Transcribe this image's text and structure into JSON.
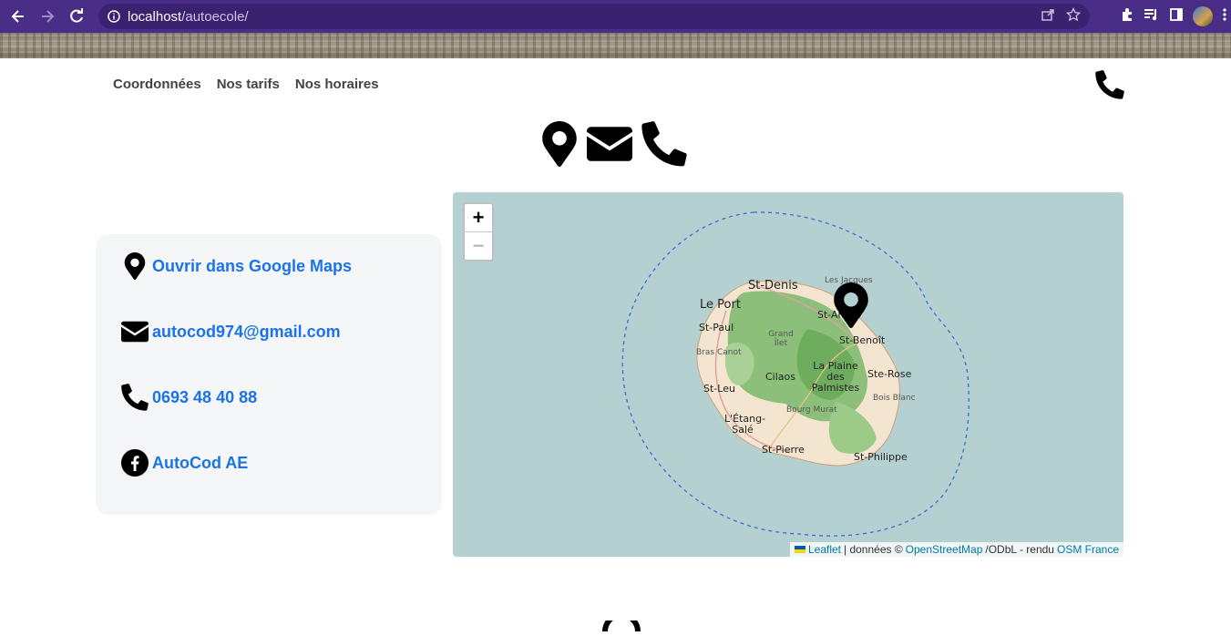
{
  "browser": {
    "url_host": "localhost",
    "url_path": "/autoecole/"
  },
  "nav": {
    "items": [
      "Coordonnées",
      "Nos tarifs",
      "Nos horaires"
    ]
  },
  "contact": {
    "maps_label": "Ouvrir dans Google Maps",
    "email": "autocod974@gmail.com",
    "phone": "0693 48 40 88",
    "facebook": "AutoCod AE"
  },
  "map": {
    "zoom_in": "+",
    "zoom_out": "−",
    "attribution": {
      "leaflet": "Leaflet",
      "sep": "| données ©",
      "osm": "OpenStreetMap",
      "odbl": "/ODbL - rendu",
      "osmfr": "OSM France"
    },
    "places": {
      "st_denis": "St-Denis",
      "le_port": "Le Port",
      "les_jacques": "Les Jacques",
      "st_andre": "St-André",
      "st_paul": "St-Paul",
      "grand_ilet": "Grand Îlet",
      "st_benoit": "St-Benoît",
      "bras_canot": "Bras Canot",
      "cilaos": "Cilaos",
      "la_plaine": "La Plaine des Palmistes",
      "ste_rose": "Ste-Rose",
      "st_leu": "St-Leu",
      "bois_blanc": "Bois Blanc",
      "bourg_murat": "Bourg Murat",
      "etang_sale": "L'Étang-Salé",
      "st_pierre": "St-Pierre",
      "st_philippe": "St-Philippe"
    }
  },
  "colors": {
    "chrome": "#4a2d86",
    "link": "#1a73e8",
    "map_sea": "#b5d0d0",
    "map_land": "#7fb86a"
  }
}
